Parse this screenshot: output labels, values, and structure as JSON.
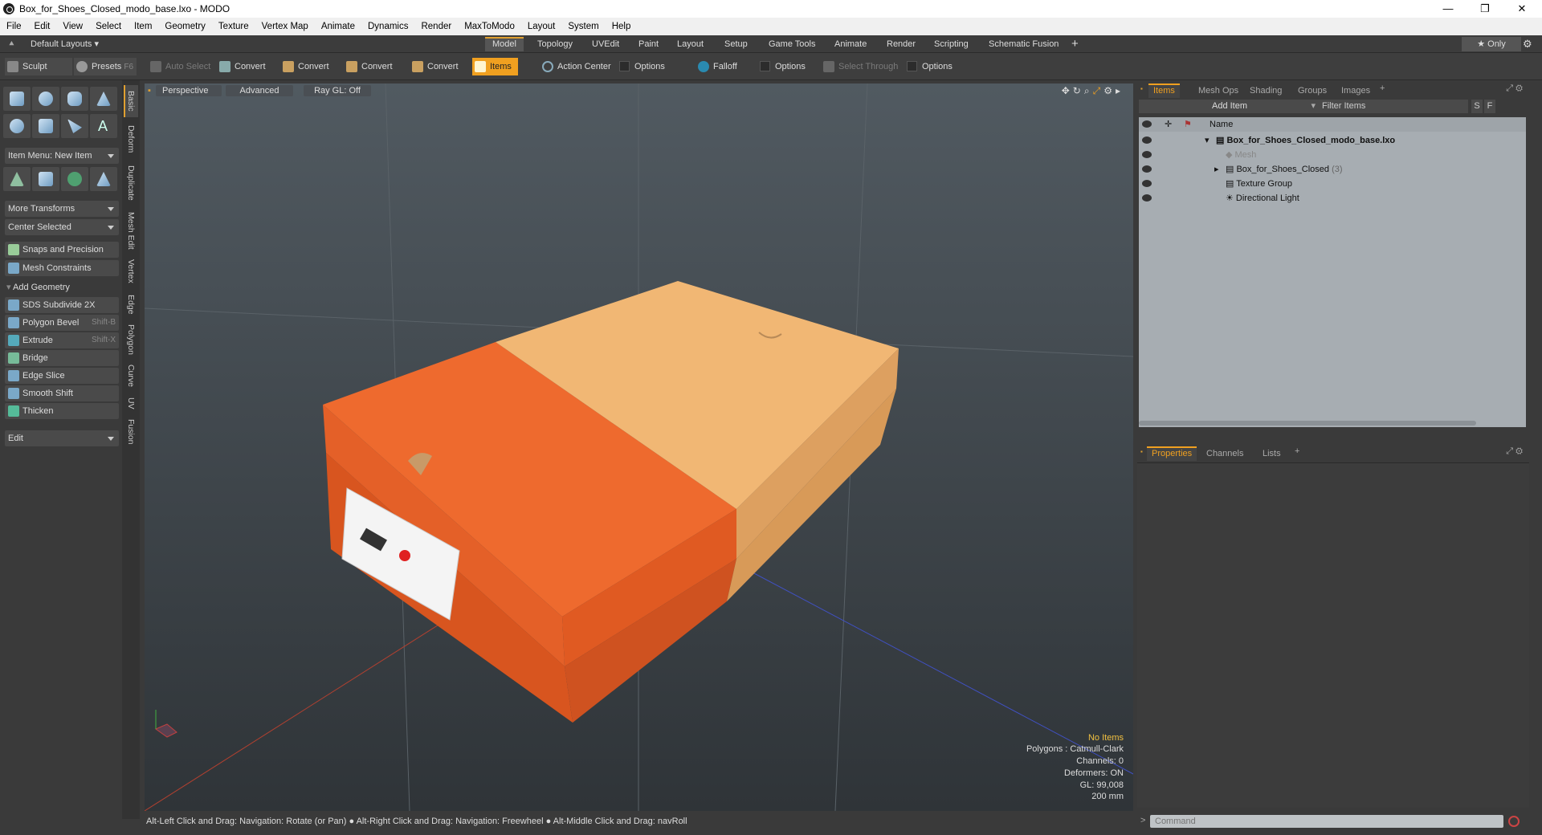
{
  "window": {
    "title": "Box_for_Shoes_Closed_modo_base.lxo - MODO",
    "min": "—",
    "max": "❐",
    "close": "✕"
  },
  "menu": [
    "File",
    "Edit",
    "View",
    "Select",
    "Item",
    "Geometry",
    "Texture",
    "Vertex Map",
    "Animate",
    "Dynamics",
    "Render",
    "MaxToModo",
    "Layout",
    "System",
    "Help"
  ],
  "layoutbar": {
    "preset": "Default Layouts ▾",
    "tabs": [
      "Model",
      "Topology",
      "UVEdit",
      "Paint",
      "Layout",
      "Setup",
      "Game Tools",
      "Animate",
      "Render",
      "Scripting",
      "Schematic Fusion"
    ],
    "plus": "+",
    "only": "★ Only"
  },
  "toolbar": {
    "sculpt": "Sculpt",
    "presets": "Presets",
    "presets_key": "F6",
    "auto_select": "Auto Select",
    "convert1": "Convert",
    "convert2": "Convert",
    "convert3": "Convert",
    "convert4": "Convert",
    "items": "Items",
    "action_center": "Action Center",
    "options1": "Options",
    "falloff": "Falloff",
    "options2": "Options",
    "select_through": "Select Through",
    "options3": "Options"
  },
  "left": {
    "item_menu": "Item Menu: New Item",
    "more_transforms": "More Transforms",
    "center_selected": "Center Selected",
    "snaps": "Snaps and Precision",
    "mesh_constraints": "Mesh Constraints",
    "add_geometry": "Add Geometry",
    "tools": [
      {
        "label": "SDS Subdivide 2X",
        "key": ""
      },
      {
        "label": "Polygon Bevel",
        "key": "Shift-B"
      },
      {
        "label": "Extrude",
        "key": "Shift-X"
      },
      {
        "label": "Bridge",
        "key": ""
      },
      {
        "label": "Edge Slice",
        "key": ""
      },
      {
        "label": "Smooth Shift",
        "key": ""
      },
      {
        "label": "Thicken",
        "key": ""
      }
    ],
    "edit": "Edit"
  },
  "vtabs": [
    "Basic",
    "Deform",
    "Duplicate",
    "Mesh Edit",
    "Vertex",
    "Edge",
    "Polygon",
    "Curve",
    "UV",
    "Fusion"
  ],
  "viewport": {
    "perspective": "Perspective",
    "advanced": "Advanced",
    "raygl": "Ray GL: Off",
    "info": {
      "items": "No Items",
      "polygons": "Polygons : Catmull-Clark",
      "channels": "Channels: 0",
      "deformers": "Deformers: ON",
      "gl": "GL: 99,008",
      "scale": "200 mm"
    }
  },
  "status": "Alt-Left Click and Drag: Navigation: Rotate (or Pan) ● Alt-Right Click and Drag: Navigation: Freewheel ● Alt-Middle Click and Drag: navRoll",
  "items_panel": {
    "tabs": [
      "Items",
      "Mesh Ops",
      "Shading",
      "Groups",
      "Images"
    ],
    "plus": "+",
    "add_item": "Add Item",
    "filter": "Filter Items",
    "s": "S",
    "f": "F",
    "col_name": "Name",
    "rows": [
      {
        "name": "Box_for_Shoes_Closed_modo_base.lxo",
        "suffix": ""
      },
      {
        "name": "Mesh",
        "suffix": ""
      },
      {
        "name": "Box_for_Shoes_Closed",
        "suffix": "(3)"
      },
      {
        "name": "Texture Group",
        "suffix": ""
      },
      {
        "name": "Directional Light",
        "suffix": ""
      }
    ]
  },
  "props_panel": {
    "tabs": [
      "Properties",
      "Channels",
      "Lists"
    ],
    "plus": "+"
  },
  "command": {
    "placeholder": "Command",
    "prompt": ">"
  }
}
